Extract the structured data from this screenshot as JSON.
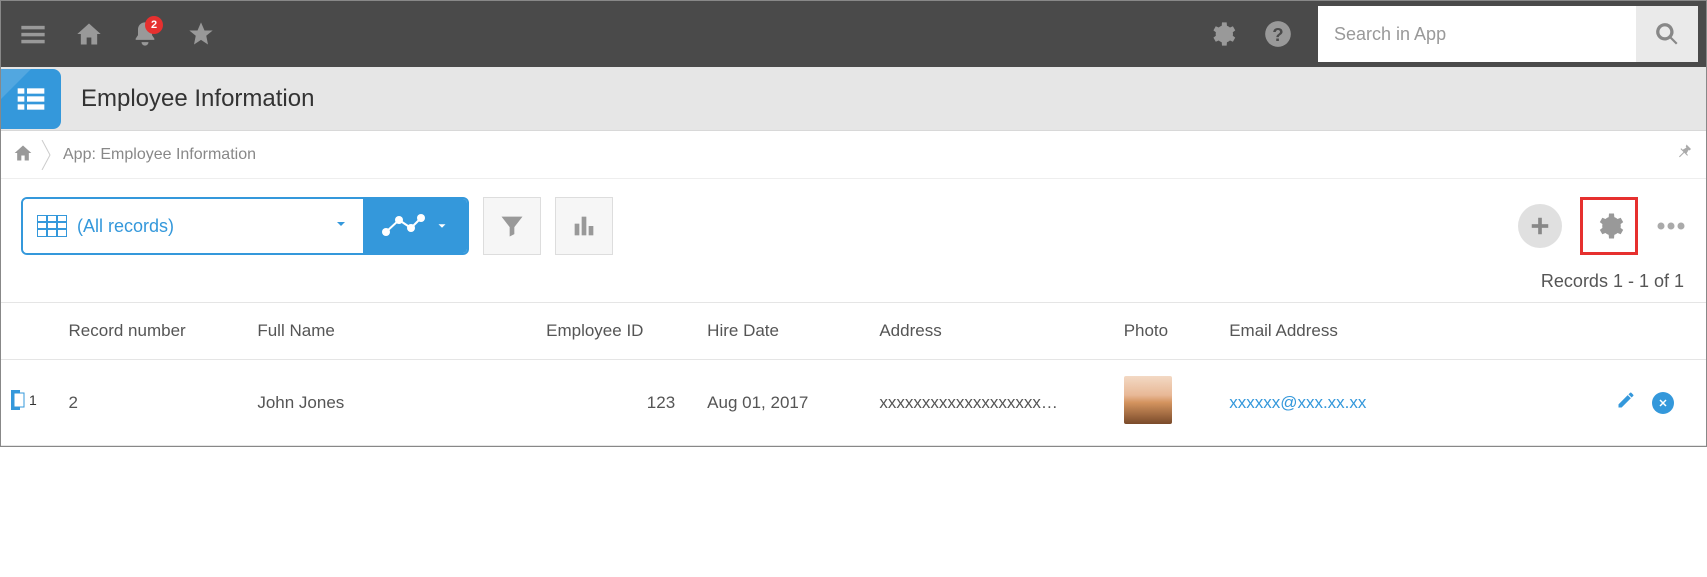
{
  "header": {
    "notification_count": "2",
    "search_placeholder": "Search in App"
  },
  "app": {
    "title": "Employee Information"
  },
  "breadcrumb": {
    "text": "App: Employee Information"
  },
  "toolbar": {
    "view_label": "(All records)"
  },
  "records_count": "Records 1 - 1 of 1",
  "table": {
    "columns": {
      "record_number": "Record number",
      "full_name": "Full Name",
      "employee_id": "Employee ID",
      "hire_date": "Hire Date",
      "address": "Address",
      "photo": "Photo",
      "email": "Email Address"
    },
    "rows": [
      {
        "index": "1",
        "record_number": "2",
        "full_name": "John Jones",
        "employee_id": "123",
        "hire_date": "Aug 01, 2017",
        "address": "xxxxxxxxxxxxxxxxxxx…",
        "email": "xxxxxx@xxx.xx.xx"
      }
    ]
  }
}
